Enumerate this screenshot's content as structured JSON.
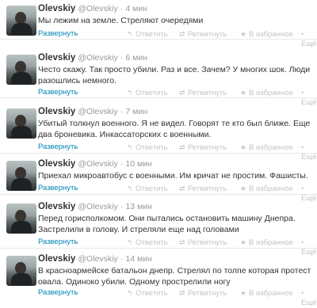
{
  "tweets": [
    {
      "name": "Olevskiy",
      "handle": "@Olevskiy",
      "time": "4 мин",
      "text": "Мы лежим на земле. Стреляют очередями",
      "expand": "Развернуть",
      "reply": "Ответить",
      "retweet": "Ретвитнуть",
      "favorite": "В избранное",
      "more": "Ещё"
    },
    {
      "name": "Olevskiy",
      "handle": "@Olevskiy",
      "time": "6 мин",
      "text": "Често скажу. Так просто убили. Раз и все. Зачем? У многих шок. Люди разошлись немного.",
      "expand": "Развернуть",
      "reply": "Ответить",
      "retweet": "Ретвитнуть",
      "favorite": "В избранное",
      "more": "Ещё"
    },
    {
      "name": "Olevskiy",
      "handle": "@Olevskiy",
      "time": "7 мин",
      "text": "Убитый толкнул военного. Я не видел. Говорят те кто был ближе. Еще два броневика. Инкассаторских с военными.",
      "expand": "Развернуть",
      "reply": "Ответить",
      "retweet": "Ретвитнуть",
      "favorite": "В избранное",
      "more": "Ещё"
    },
    {
      "name": "Olevskiy",
      "handle": "@Olevskiy",
      "time": "10 мин",
      "text": "Приехал микроавтобус с военными. Им кричат не простим.  Фашисты.",
      "expand": "Развернуть",
      "reply": "Ответить",
      "retweet": "Ретвитнуть",
      "favorite": "В избранное",
      "more": "Ещё"
    },
    {
      "name": "Olevskiy",
      "handle": "@Olevskiy",
      "time": "13 мин",
      "text": "Перед горисполкомом. Они пытались остановить машину Днепра. Застрелили в голову. И стреляли еще над головами",
      "expand": "Развернуть",
      "reply": "Ответить",
      "retweet": "Ретвитнуть",
      "favorite": "В избранное",
      "more": "Ещё"
    },
    {
      "name": "Olevskiy",
      "handle": "@Olevskiy",
      "time": "14 мин",
      "text": "В красноармейске батальон днепр. Стрелял по толпе которая протест овала.  Одиноко убили. Одному прострелили ногу",
      "expand": "Развернуть",
      "reply": "Ответить",
      "retweet": "Ретвитнуть",
      "favorite": "В избранное",
      "more": "Ещё"
    }
  ]
}
